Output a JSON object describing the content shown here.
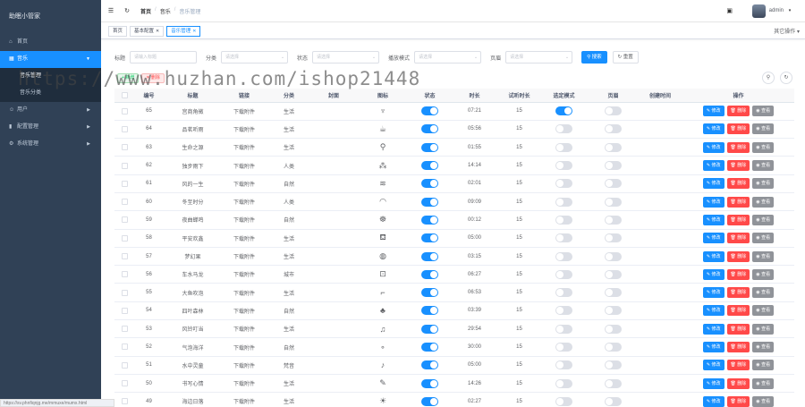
{
  "app": {
    "title": "助眠小管家"
  },
  "sidebar": {
    "items": [
      {
        "label": "首页",
        "icon": "home-icon"
      },
      {
        "label": "音乐",
        "icon": "grid-icon",
        "active": true
      },
      {
        "label": "音乐管理",
        "sub": true,
        "selected": true
      },
      {
        "label": "音乐分类",
        "sub": true
      },
      {
        "label": "用户",
        "icon": "user-icon"
      },
      {
        "label": "配置管理",
        "icon": "chart-icon"
      },
      {
        "label": "系统管理",
        "icon": "gear-icon"
      }
    ]
  },
  "status_url": "https://sv.phnfiqnjg.me/mmuxe/mumx.html",
  "navbar": {
    "crumbs": [
      "首页",
      "/",
      "音乐",
      "/",
      "音乐管理"
    ],
    "user": "admin"
  },
  "tags": [
    {
      "label": "首页",
      "closable": false
    },
    {
      "label": "基本配置",
      "closable": true
    },
    {
      "label": "音乐管理",
      "closable": true,
      "active": true
    }
  ],
  "tags_more": "其它操作",
  "search": {
    "fields": [
      {
        "label": "标题",
        "placeholder": "请输入标题",
        "select": false
      },
      {
        "label": "分类",
        "placeholder": "请选择",
        "select": true
      },
      {
        "label": "状态",
        "placeholder": "请选择",
        "select": true
      },
      {
        "label": "播放模式",
        "placeholder": "请选择",
        "select": true
      },
      {
        "label": "页眉",
        "placeholder": "请选择",
        "select": true
      }
    ],
    "query_label": "搜索",
    "reset_label": "重置"
  },
  "toolbar": {
    "add_label": "新增",
    "delete_label": "删除"
  },
  "watermark": "https://www.huzhan.com/ishop21448",
  "table": {
    "headers": [
      "",
      "编号",
      "标题",
      "链接",
      "分类",
      "封面",
      "图标",
      "状态",
      "时长",
      "试听时长",
      "选定模式",
      "页眉",
      "创建时间",
      "操作"
    ],
    "op_labels": {
      "edit": "修改",
      "delete": "删除",
      "view": "查看"
    },
    "rows": [
      {
        "id": "65",
        "title": "宫商角徵",
        "link": "下载附件",
        "category": "生活",
        "icon": "harp-icon",
        "status": true,
        "duration": "07:21",
        "trial": "15",
        "mode": true,
        "header": false
      },
      {
        "id": "64",
        "title": "品茗听雨",
        "link": "下载附件",
        "category": "生活",
        "icon": "teapot-icon",
        "status": true,
        "duration": "05:56",
        "trial": "15",
        "mode": false,
        "header": false
      },
      {
        "id": "63",
        "title": "生命之源",
        "link": "下载附件",
        "category": "生活",
        "icon": "faucet-icon",
        "status": true,
        "duration": "01:55",
        "trial": "15",
        "mode": false,
        "header": false
      },
      {
        "id": "62",
        "title": "独步雨下",
        "link": "下载附件",
        "category": "人类",
        "icon": "footprint-icon",
        "status": true,
        "duration": "14:14",
        "trial": "15",
        "mode": false,
        "header": false
      },
      {
        "id": "61",
        "title": "风的一生",
        "link": "下载附件",
        "category": "自然",
        "icon": "wind-icon",
        "status": true,
        "duration": "02:01",
        "trial": "15",
        "mode": false,
        "header": false
      },
      {
        "id": "60",
        "title": "冬至时分",
        "link": "下载附件",
        "category": "人类",
        "icon": "lips-icon",
        "status": true,
        "duration": "09:09",
        "trial": "15",
        "mode": false,
        "header": false
      },
      {
        "id": "59",
        "title": "夜曲蝉鸣",
        "link": "下载附件",
        "category": "自然",
        "icon": "bug-icon",
        "status": true,
        "duration": "00:12",
        "trial": "15",
        "mode": false,
        "header": false
      },
      {
        "id": "58",
        "title": "平安欢鑫",
        "link": "下载附件",
        "category": "生活",
        "icon": "cup-icon",
        "status": true,
        "duration": "05:00",
        "trial": "15",
        "mode": false,
        "header": false
      },
      {
        "id": "57",
        "title": "梦幻果",
        "link": "下载附件",
        "category": "生活",
        "icon": "apple-icon",
        "status": true,
        "duration": "03:15",
        "trial": "15",
        "mode": false,
        "header": false
      },
      {
        "id": "56",
        "title": "车水马龙",
        "link": "下载附件",
        "category": "城市",
        "icon": "car-icon",
        "status": true,
        "duration": "06:27",
        "trial": "15",
        "mode": false,
        "header": false
      },
      {
        "id": "55",
        "title": "大鱼吹泡",
        "link": "下载附件",
        "category": "生活",
        "icon": "hairdryer-icon",
        "status": true,
        "duration": "06:53",
        "trial": "15",
        "mode": false,
        "header": false
      },
      {
        "id": "54",
        "title": "四叶森林",
        "link": "下载附件",
        "category": "自然",
        "icon": "forest-icon",
        "status": true,
        "duration": "03:39",
        "trial": "15",
        "mode": false,
        "header": false
      },
      {
        "id": "53",
        "title": "风铃叮当",
        "link": "下载附件",
        "category": "生活",
        "icon": "bell-icon",
        "status": true,
        "duration": "29:54",
        "trial": "15",
        "mode": false,
        "header": false
      },
      {
        "id": "52",
        "title": "气泡海洋",
        "link": "下载附件",
        "category": "自然",
        "icon": "bubbles-icon",
        "status": true,
        "duration": "30:00",
        "trial": "15",
        "mode": false,
        "header": false
      },
      {
        "id": "51",
        "title": "水中灵童",
        "link": "下载附件",
        "category": "梵音",
        "icon": "music-note-icon",
        "status": true,
        "duration": "05:00",
        "trial": "15",
        "mode": false,
        "header": false
      },
      {
        "id": "50",
        "title": "书写心情",
        "link": "下载附件",
        "category": "生活",
        "icon": "pen-icon",
        "status": true,
        "duration": "14:26",
        "trial": "15",
        "mode": false,
        "header": false
      },
      {
        "id": "49",
        "title": "海边日落",
        "link": "下载附件",
        "category": "生活",
        "icon": "sun-icon",
        "status": true,
        "duration": "02:27",
        "trial": "15",
        "mode": false,
        "header": false
      }
    ]
  }
}
